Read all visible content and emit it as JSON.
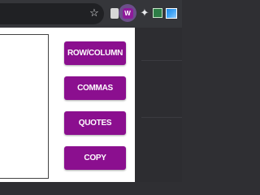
{
  "toolbar": {
    "icons": [
      "star-icon",
      "extension-icon",
      "csv-extension-icon",
      "wand-icon",
      "checkbox-extension-icon",
      "image-extension-icon"
    ],
    "active_extension_label": "W"
  },
  "popup": {
    "buttons": [
      {
        "label": "ROW/COLUMN"
      },
      {
        "label": "COMMAS"
      },
      {
        "label": "QUOTES"
      },
      {
        "label": "COPY"
      }
    ]
  },
  "colors": {
    "button_bg": "#8b0f8f",
    "toolbar_bg": "#35363a"
  }
}
